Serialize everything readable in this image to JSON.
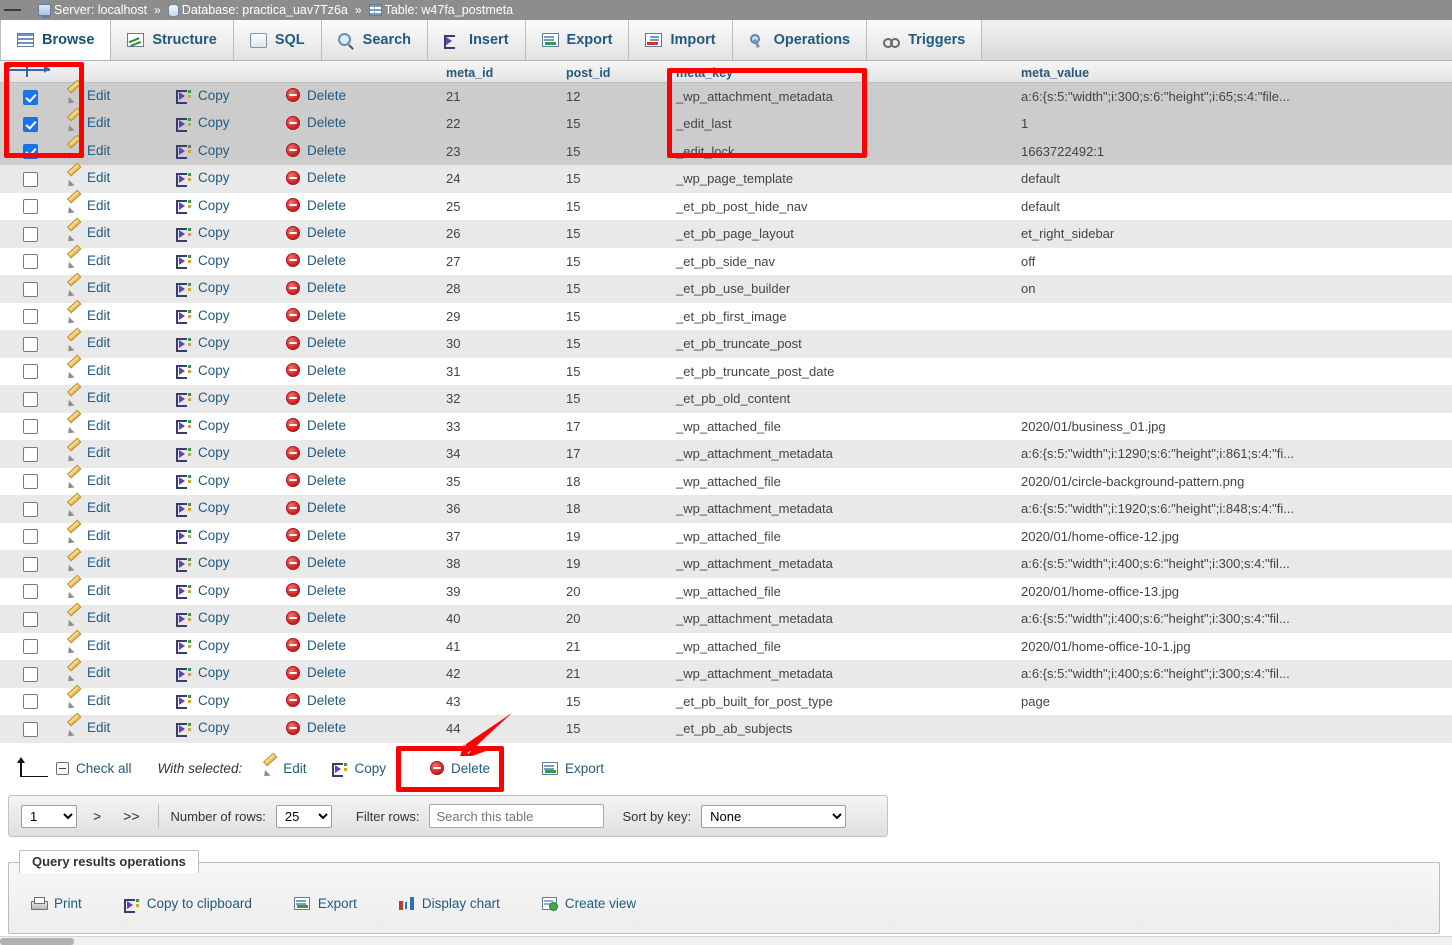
{
  "breadcrumb": {
    "server_label": "Server: localhost",
    "sep1": "»",
    "database_label": "Database: practica_uav7Tz6a",
    "sep2": "»",
    "table_label": "Table: w47fa_postmeta"
  },
  "tabs": [
    {
      "label": "Browse",
      "icon": "browse-icon",
      "active": true
    },
    {
      "label": "Structure",
      "icon": "structure-icon",
      "active": false
    },
    {
      "label": "SQL",
      "icon": "sql-icon",
      "active": false
    },
    {
      "label": "Search",
      "icon": "search-icon",
      "active": false
    },
    {
      "label": "Insert",
      "icon": "insert-icon",
      "active": false
    },
    {
      "label": "Export",
      "icon": "export-icon",
      "active": false
    },
    {
      "label": "Import",
      "icon": "import-icon",
      "active": false
    },
    {
      "label": "Operations",
      "icon": "wrench-icon",
      "active": false
    },
    {
      "label": "Triggers",
      "icon": "triggers-icon",
      "active": false
    }
  ],
  "table": {
    "row_actions": {
      "edit": "Edit",
      "copy": "Copy",
      "delete": "Delete"
    },
    "columns": [
      "meta_id",
      "post_id",
      "meta_key",
      "meta_value"
    ],
    "rows": [
      {
        "checked": true,
        "meta_id": "21",
        "post_id": "12",
        "meta_key": "_wp_attachment_metadata",
        "meta_value": "a:6:{s:5:\"width\";i:300;s:6:\"height\";i:65;s:4:\"file..."
      },
      {
        "checked": true,
        "meta_id": "22",
        "post_id": "15",
        "meta_key": "_edit_last",
        "meta_value": "1"
      },
      {
        "checked": true,
        "meta_id": "23",
        "post_id": "15",
        "meta_key": "_edit_lock",
        "meta_value": "1663722492:1"
      },
      {
        "checked": false,
        "meta_id": "24",
        "post_id": "15",
        "meta_key": "_wp_page_template",
        "meta_value": "default"
      },
      {
        "checked": false,
        "meta_id": "25",
        "post_id": "15",
        "meta_key": "_et_pb_post_hide_nav",
        "meta_value": "default"
      },
      {
        "checked": false,
        "meta_id": "26",
        "post_id": "15",
        "meta_key": "_et_pb_page_layout",
        "meta_value": "et_right_sidebar"
      },
      {
        "checked": false,
        "meta_id": "27",
        "post_id": "15",
        "meta_key": "_et_pb_side_nav",
        "meta_value": "off"
      },
      {
        "checked": false,
        "meta_id": "28",
        "post_id": "15",
        "meta_key": "_et_pb_use_builder",
        "meta_value": "on"
      },
      {
        "checked": false,
        "meta_id": "29",
        "post_id": "15",
        "meta_key": "_et_pb_first_image",
        "meta_value": ""
      },
      {
        "checked": false,
        "meta_id": "30",
        "post_id": "15",
        "meta_key": "_et_pb_truncate_post",
        "meta_value": ""
      },
      {
        "checked": false,
        "meta_id": "31",
        "post_id": "15",
        "meta_key": "_et_pb_truncate_post_date",
        "meta_value": ""
      },
      {
        "checked": false,
        "meta_id": "32",
        "post_id": "15",
        "meta_key": "_et_pb_old_content",
        "meta_value": ""
      },
      {
        "checked": false,
        "meta_id": "33",
        "post_id": "17",
        "meta_key": "_wp_attached_file",
        "meta_value": "2020/01/business_01.jpg"
      },
      {
        "checked": false,
        "meta_id": "34",
        "post_id": "17",
        "meta_key": "_wp_attachment_metadata",
        "meta_value": "a:6:{s:5:\"width\";i:1290;s:6:\"height\";i:861;s:4:\"fi..."
      },
      {
        "checked": false,
        "meta_id": "35",
        "post_id": "18",
        "meta_key": "_wp_attached_file",
        "meta_value": "2020/01/circle-background-pattern.png"
      },
      {
        "checked": false,
        "meta_id": "36",
        "post_id": "18",
        "meta_key": "_wp_attachment_metadata",
        "meta_value": "a:6:{s:5:\"width\";i:1920;s:6:\"height\";i:848;s:4:\"fi..."
      },
      {
        "checked": false,
        "meta_id": "37",
        "post_id": "19",
        "meta_key": "_wp_attached_file",
        "meta_value": "2020/01/home-office-12.jpg"
      },
      {
        "checked": false,
        "meta_id": "38",
        "post_id": "19",
        "meta_key": "_wp_attachment_metadata",
        "meta_value": "a:6:{s:5:\"width\";i:400;s:6:\"height\";i:300;s:4:\"fil..."
      },
      {
        "checked": false,
        "meta_id": "39",
        "post_id": "20",
        "meta_key": "_wp_attached_file",
        "meta_value": "2020/01/home-office-13.jpg"
      },
      {
        "checked": false,
        "meta_id": "40",
        "post_id": "20",
        "meta_key": "_wp_attachment_metadata",
        "meta_value": "a:6:{s:5:\"width\";i:400;s:6:\"height\";i:300;s:4:\"fil..."
      },
      {
        "checked": false,
        "meta_id": "41",
        "post_id": "21",
        "meta_key": "_wp_attached_file",
        "meta_value": "2020/01/home-office-10-1.jpg"
      },
      {
        "checked": false,
        "meta_id": "42",
        "post_id": "21",
        "meta_key": "_wp_attachment_metadata",
        "meta_value": "a:6:{s:5:\"width\";i:400;s:6:\"height\";i:300;s:4:\"fil..."
      },
      {
        "checked": false,
        "meta_id": "43",
        "post_id": "15",
        "meta_key": "_et_pb_built_for_post_type",
        "meta_value": "page"
      },
      {
        "checked": false,
        "meta_id": "44",
        "post_id": "15",
        "meta_key": "_et_pb_ab_subjects",
        "meta_value": ""
      }
    ]
  },
  "with_selected": {
    "check_all": "Check all",
    "label": "With selected:",
    "edit": "Edit",
    "copy": "Copy",
    "delete": "Delete",
    "export": "Export"
  },
  "pagination": {
    "page_value": "1",
    "next": ">",
    "last": ">>",
    "rows_label": "Number of rows:",
    "rows_value": "25",
    "filter_label": "Filter rows:",
    "filter_placeholder": "Search this table",
    "filter_value": "",
    "sort_label": "Sort by key:",
    "sort_value": "None"
  },
  "query_results": {
    "legend": "Query results operations",
    "links": [
      {
        "label": "Print",
        "icon": "printer-icon"
      },
      {
        "label": "Copy to clipboard",
        "icon": "copy-icon"
      },
      {
        "label": "Export",
        "icon": "export-icon"
      },
      {
        "label": "Display chart",
        "icon": "chart-icon"
      },
      {
        "label": "Create view",
        "icon": "create-view-icon"
      }
    ]
  },
  "annotations": {
    "accent_color": "#ff0000",
    "checkbox_highlight": "selected rows checkbox group",
    "metakey_highlight": "meta_key values of selected rows",
    "delete_highlight": "Delete action in With selected toolbar"
  }
}
